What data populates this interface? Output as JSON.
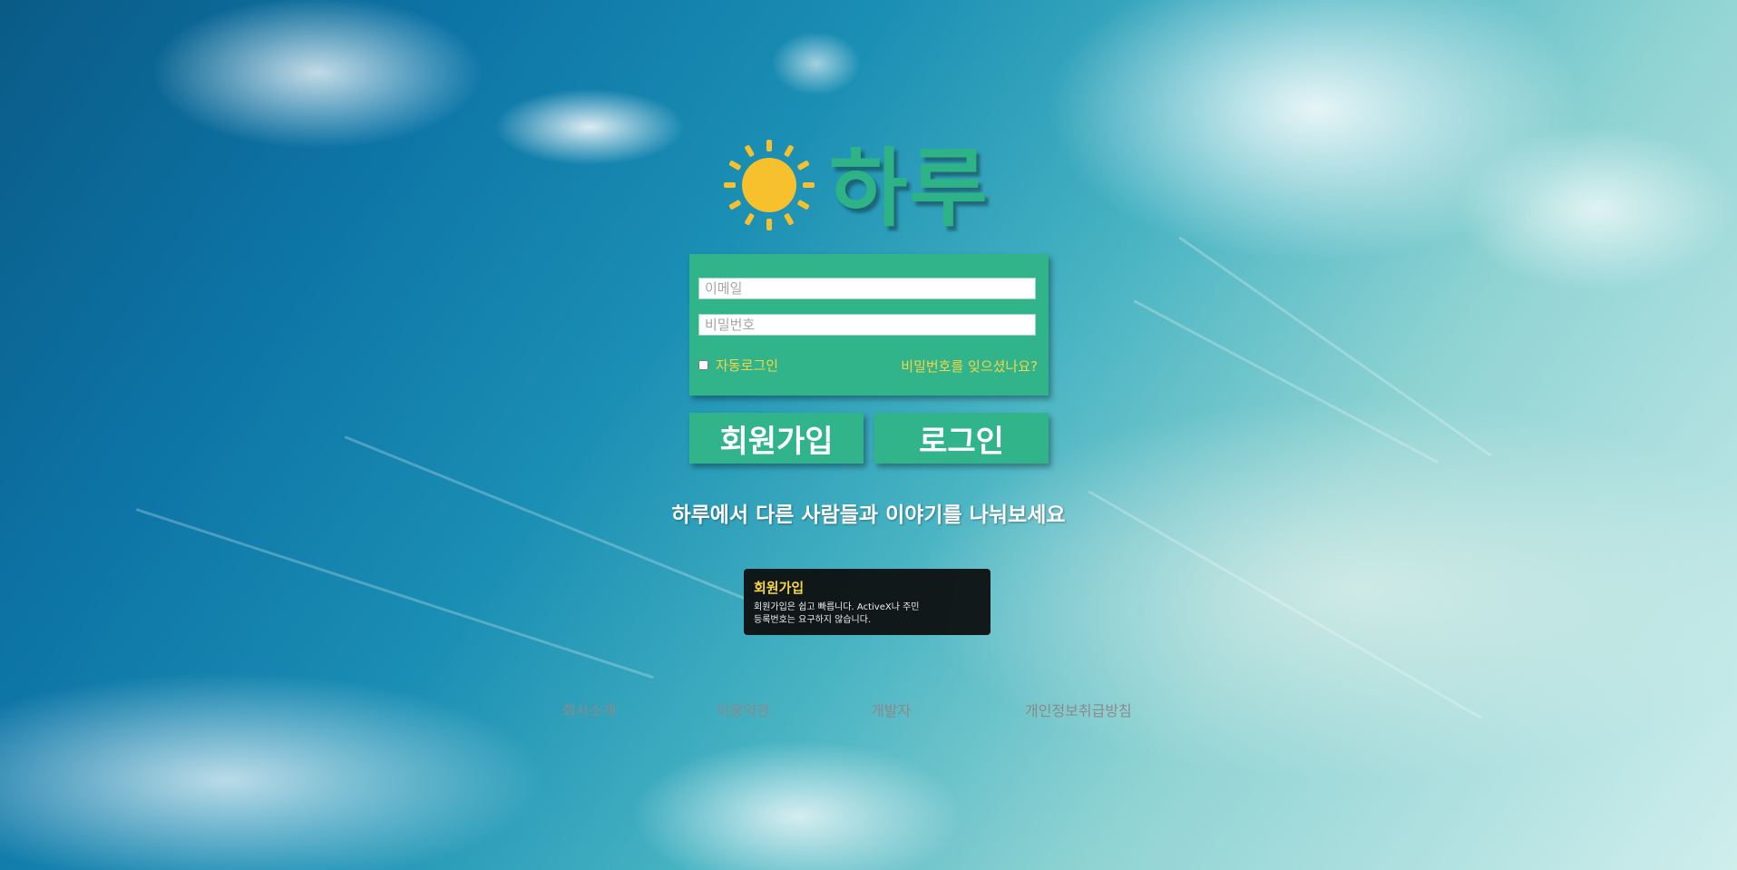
{
  "brand": {
    "name": "하루",
    "logo_color": "#2eb386",
    "sun_color": "#f6c12c"
  },
  "login": {
    "email_placeholder": "이메일",
    "password_placeholder": "비밀번호",
    "auto_login_label": "자동로그인",
    "forgot_password": "비밀번호를 잊으셨나요?",
    "box_color": "#32b48a",
    "accent_text_color": "#f5d547"
  },
  "buttons": {
    "signup": "회원가입",
    "login": "로그인"
  },
  "tagline": "하루에서 다른 사람들과 이야기를 나눠보세요",
  "tooltip": {
    "title": "회원가입",
    "body": "회원가입은 쉽고 빠릅니다. ActiveX나 주민등록번호는 요구하지 않습니다."
  },
  "footer": {
    "links": [
      "회사소개",
      "이용약관",
      "개발자",
      "개인정보취급방침"
    ]
  }
}
